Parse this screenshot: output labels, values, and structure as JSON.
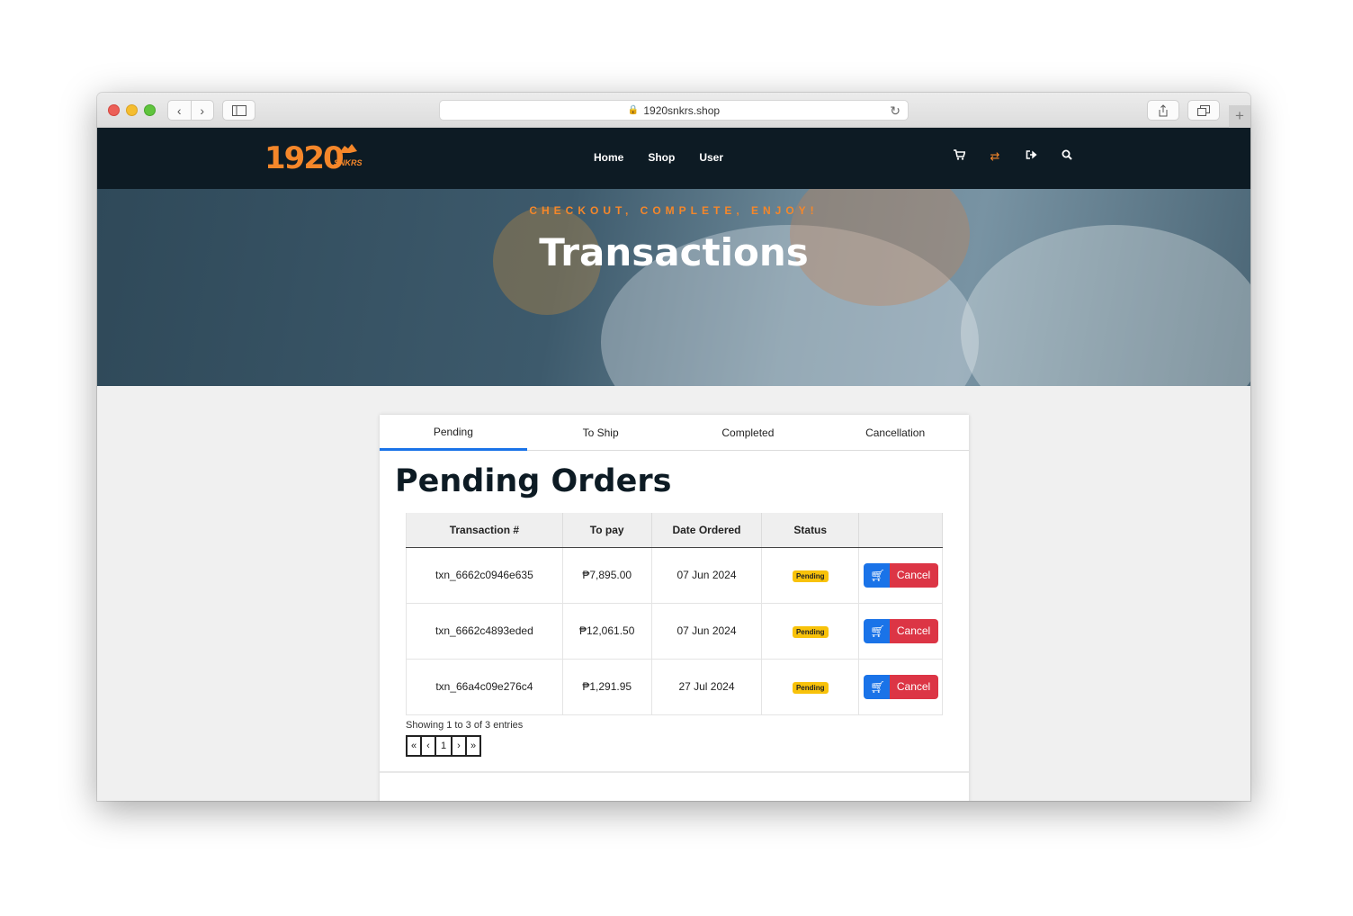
{
  "browser": {
    "url": "1920snkrs.shop"
  },
  "header": {
    "logo_text": "1920",
    "logo_sub": "SNKRS",
    "nav": [
      "Home",
      "Shop",
      "User"
    ],
    "icons": [
      "cart-icon",
      "exchange-icon",
      "logout-icon",
      "search-icon"
    ],
    "accent_color": "#f5872a",
    "background_color": "#0d1b24"
  },
  "hero": {
    "subtitle": "CHECKOUT, COMPLETE, ENJOY!",
    "title": "Transactions"
  },
  "tabs": [
    "Pending",
    "To Ship",
    "Completed",
    "Cancellation"
  ],
  "active_tab": "Pending",
  "panel": {
    "title": "Pending Orders"
  },
  "table": {
    "columns": [
      "Transaction #",
      "To pay",
      "Date Ordered",
      "Status",
      ""
    ],
    "rows": [
      {
        "txn": "txn_6662c0946e635",
        "to_pay": "₱7,895.00",
        "date": "07 Jun 2024",
        "status": "Pending"
      },
      {
        "txn": "txn_6662c4893eded",
        "to_pay": "₱12,061.50",
        "date": "07 Jun 2024",
        "status": "Pending"
      },
      {
        "txn": "txn_66a4c09e276c4",
        "to_pay": "₱1,291.95",
        "date": "27 Jul 2024",
        "status": "Pending"
      }
    ],
    "action_cancel_label": "Cancel"
  },
  "pagination": {
    "summary": "Showing 1 to 3 of 3 entries",
    "first": "«",
    "prev": "‹",
    "page": "1",
    "next": "›",
    "last": "»"
  }
}
